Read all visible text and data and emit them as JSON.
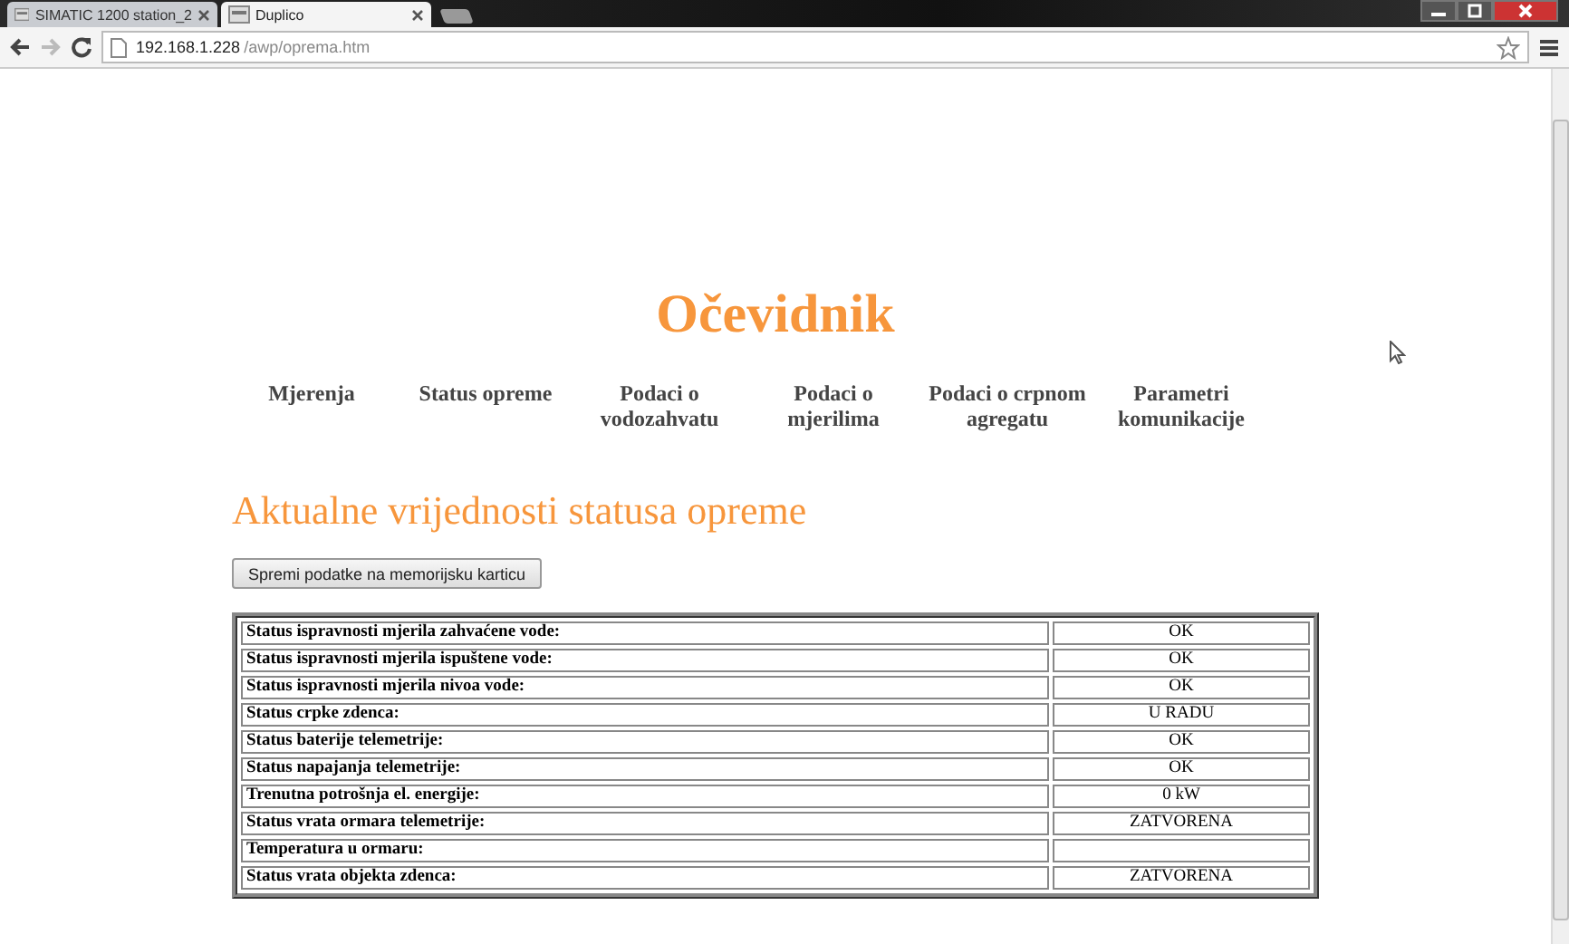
{
  "browser": {
    "tabs": [
      {
        "title": "SIMATIC 1200 station_2",
        "selected": false
      },
      {
        "title": "Duplico",
        "selected": true
      }
    ],
    "url_host": "192.168.1.228",
    "url_path": "/awp/oprema.htm"
  },
  "page": {
    "title": "Očevidnik",
    "nav": [
      {
        "label": "Mjerenja"
      },
      {
        "label": "Status opreme"
      },
      {
        "label": "Podaci o vodozahvatu"
      },
      {
        "label": "Podaci o mjerilima"
      },
      {
        "label": "Podaci o crpnom agregatu"
      },
      {
        "label": "Parametri komunikacije"
      }
    ],
    "heading": "Aktualne vrijednosti statusa opreme",
    "save_button": "Spremi podatke na memorijsku karticu",
    "table": {
      "rows": [
        {
          "label": "Status ispravnosti mjerila zahvaćene vode:",
          "value": "OK"
        },
        {
          "label": "Status ispravnosti mjerila ispuštene vode:",
          "value": "OK"
        },
        {
          "label": "Status ispravnosti mjerila nivoa vode:",
          "value": "OK"
        },
        {
          "label": "Status crpke zdenca:",
          "value": "U RADU"
        },
        {
          "label": "Status baterije telemetrije:",
          "value": "OK"
        },
        {
          "label": "Status napajanja telemetrije:",
          "value": "OK"
        },
        {
          "label": "Trenutna potrošnja el. energije:",
          "value": "0 kW"
        },
        {
          "label": "Status vrata ormara telemetrije:",
          "value": "ZATVORENA"
        },
        {
          "label": "Temperatura u ormaru:",
          "value": null
        },
        {
          "label": "Status vrata objekta zdenca:",
          "value": "ZATVORENA"
        }
      ]
    }
  }
}
